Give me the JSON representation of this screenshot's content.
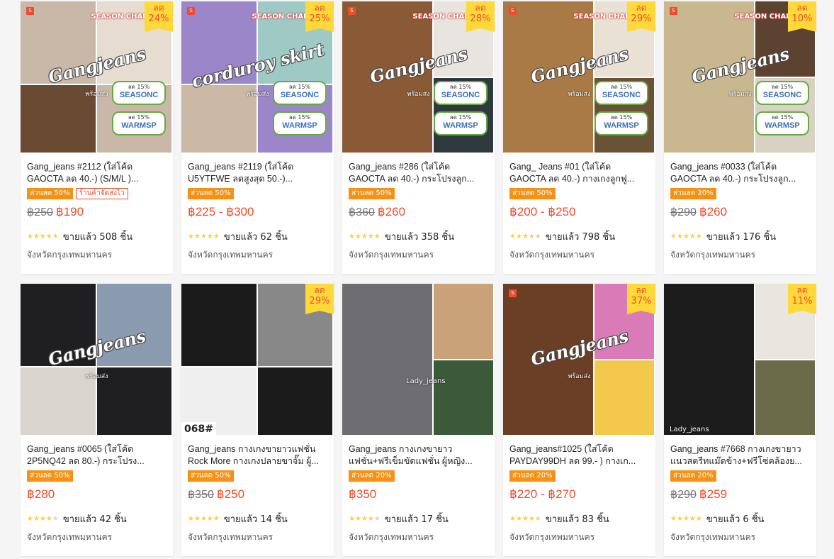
{
  "products": [
    {
      "title": "Gang_jeans #2112 (ใส่โค้ด GAOCTA ลด 40.-) (S/M/L )...",
      "discount_badge": {
        "top": "ลด",
        "pct": "24%"
      },
      "tags": [
        "ส่วนลด 50%",
        "ร้านค้าจัดส่งไว"
      ],
      "old_price": "฿250",
      "price": "฿190",
      "rating": 5,
      "sold": "ขายแล้ว 508 ชิ้น",
      "location": "จังหวัดกรุงเทพมหานคร",
      "thumb_colors": [
        "#c9b8a8",
        "#6b4a33",
        "#e6dccf"
      ],
      "watermark": "Gangjeans"
    },
    {
      "title": "Gang_jeans #2119 (ใส่โค้ด U5YTFWE ลดสูงสุด 50.-)...",
      "discount_badge": {
        "top": "ลด",
        "pct": "25%"
      },
      "tags": [
        "ส่วนลด 50%"
      ],
      "old_price": "",
      "price": "฿225 - ฿300",
      "rating": 5,
      "sold": "ขายแล้ว 62 ชิ้น",
      "location": "จังหวัดกรุงเทพมหานคร",
      "thumb_colors": [
        "#9b86c9",
        "#cbb9a5",
        "#9fc9c4"
      ],
      "watermark": "corduroy skirt"
    },
    {
      "title": "Gang_jeans #286 (ใส่โค้ด GAOCTA ลด 40.-) กระโปรงลูก...",
      "discount_badge": {
        "top": "ลด",
        "pct": "28%"
      },
      "tags": [
        "ส่วนลด 50%"
      ],
      "old_price": "฿360",
      "price": "฿260",
      "rating": 5,
      "sold": "ขายแล้ว 358 ชิ้น",
      "location": "จังหวัดกรุงเทพมหานคร",
      "thumb_colors": [
        "#8a5a36",
        "#e8e4df",
        "#2f3a3f"
      ],
      "watermark": "Gangjeans"
    },
    {
      "title": "Gang_ Jeans #01 (ใส่โค้ด GAOCTA ลด 40.-) กางเกงลูกฟู...",
      "discount_badge": {
        "top": "ลด",
        "pct": "29%"
      },
      "tags": [
        "ส่วนลด 50%"
      ],
      "old_price": "",
      "price": "฿200 - ฿250",
      "rating": 4.5,
      "sold": "ขายแล้ว 798 ชิ้น",
      "location": "จังหวัดกรุงเทพมหานคร",
      "thumb_colors": [
        "#a97a45",
        "#e9e2d4",
        "#6a5236"
      ],
      "watermark": "Gangjeans"
    },
    {
      "title": "Gang_jeans #0033 (ใส่โค้ด GAOCTA ลด 40.-) กระโปรงลูก...",
      "discount_badge": {
        "top": "ลด",
        "pct": "10%"
      },
      "tags": [
        "ส่วนลด 20%"
      ],
      "old_price": "฿290",
      "price": "฿260",
      "rating": 5,
      "sold": "ขายแล้ว 176 ชิ้น",
      "location": "จังหวัดกรุงเทพมหานคร",
      "thumb_colors": [
        "#c8b78f",
        "#5e4230",
        "#d8d2c2"
      ],
      "watermark": "Gangjeans"
    },
    {
      "title": "Gang_jeans #0065 (ใส่โค้ด 2P5NQ42 ลด 80.-) กระโปรง...",
      "discount_badge": null,
      "tags": [
        "ส่วนลด 50%"
      ],
      "old_price": "",
      "price": "฿280",
      "rating": 4,
      "sold": "ขายแล้ว 42 ชิ้น",
      "location": "จังหวัดกรุงเทพมหานคร",
      "thumb_colors": [
        "#1f1f22",
        "#d9d4cc",
        "#8a9bb0"
      ],
      "watermark": "Gangjeans"
    },
    {
      "title": "Gang_jeans กางเกงขายาวแฟชั่น Rock More กางเกงปลายขาจั๊ม ผู้...",
      "discount_badge": {
        "top": "ลด",
        "pct": "29%"
      },
      "tags": [
        "ส่วนลด 50%"
      ],
      "old_price": "฿350",
      "price": "฿250",
      "rating": 5,
      "sold": "ขายแล้ว 14 ชิ้น",
      "location": "จังหวัดกรุงเทพมหานคร",
      "thumb_colors": [
        "#1b1b1b",
        "#efefef",
        "#888888"
      ],
      "watermark": ""
    },
    {
      "title": "Gang_jeans กางเกงขายาว แฟชั่น+ฟรีเข็มขัดแฟชั่น ผู้หญิง...",
      "discount_badge": null,
      "tags": [
        "ส่วนลด 20%"
      ],
      "old_price": "",
      "price": "฿350",
      "rating": 4,
      "sold": "ขายแล้ว 17 ชิ้น",
      "location": "จังหวัดกรุงเทพมหานคร",
      "thumb_colors": [
        "#6e6e72",
        "#c9a27a",
        "#3b5a3a"
      ],
      "watermark": ""
    },
    {
      "title": "Gang_jeans#1025 (ใส่โค้ด PAYDAY99DH ลด 99.- ) กางเก...",
      "discount_badge": {
        "top": "ลด",
        "pct": "37%"
      },
      "tags": [
        "ส่วนลด 20%"
      ],
      "old_price": "",
      "price": "฿220 - ฿270",
      "rating": 4.5,
      "sold": "ขายแล้ว 83 ชิ้น",
      "location": "จังหวัดกรุงเทพมหานคร",
      "thumb_colors": [
        "#6b3e26",
        "#d87bb6",
        "#f2c94c"
      ],
      "watermark": "Gangjeans"
    },
    {
      "title": "Gang_jeans #7668 กางเกงขายาว แนวสตรีทแม๊ดข้าง+ฟรีโซ่คล้องย...",
      "discount_badge": {
        "top": "ลด",
        "pct": "11%"
      },
      "tags": [
        "ส่วนลด 20%"
      ],
      "old_price": "฿290",
      "price": "฿259",
      "rating": 5,
      "sold": "ขายแล้ว 6 ชิ้น",
      "location": "จังหวัดกรุงเทพมหานคร",
      "thumb_colors": [
        "#1c1c1c",
        "#e9e6e0",
        "#6b6b4a"
      ],
      "watermark": ""
    }
  ],
  "thumb_extras": {
    "season_text": "SEASON CHANGE",
    "promo1": {
      "top": "ลด 15%",
      "code": "SEASONC"
    },
    "promo2": {
      "top": "ลด 15%",
      "code": "WARMSP"
    },
    "ready": "พร้อมส่ง",
    "label_068": "068#",
    "lady_jeans": "Lady_jeans"
  },
  "colors": {
    "accent": "#ee4d2d",
    "badge_bg": "#ffd839",
    "tag_bg": "#f69113",
    "star": "#ffce3d"
  }
}
